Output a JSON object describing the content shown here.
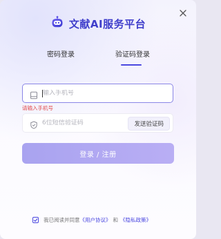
{
  "header": {
    "title": "文献AI服务平台",
    "logo_icon": "robot-icon",
    "close_icon": "close-icon"
  },
  "tabs": [
    {
      "label": "密码登录",
      "active": false
    },
    {
      "label": "验证码登录",
      "active": true
    }
  ],
  "form": {
    "phone": {
      "value": "",
      "placeholder": "输入手机号",
      "icon": "phone-icon",
      "error": "请输入手机号"
    },
    "code": {
      "value": "",
      "placeholder": "6位短信验证码",
      "icon": "shield-icon",
      "send_label": "发送验证码"
    },
    "submit_label": "登录 / 注册"
  },
  "agreement": {
    "checked": true,
    "prefix": "我已阅读并同意",
    "user_agreement": "《用户协议》",
    "and": "和",
    "privacy_policy": "《隐私政策》"
  },
  "colors": {
    "accent": "#4b48e0",
    "error": "#e24b4b",
    "button_start": "#a9a3f0",
    "button_end": "#b9aef4"
  }
}
